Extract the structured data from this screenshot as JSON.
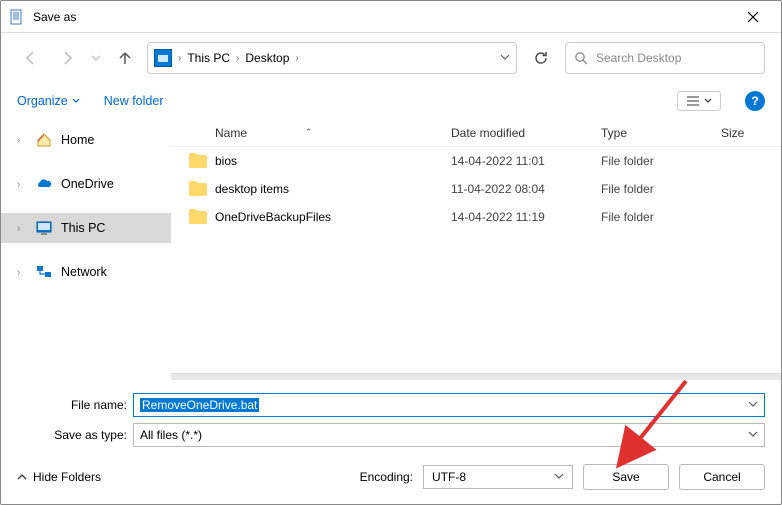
{
  "window": {
    "title": "Save as"
  },
  "address": {
    "segments": [
      "This PC",
      "Desktop"
    ],
    "search_placeholder": "Search Desktop"
  },
  "toolbar": {
    "organize": "Organize",
    "new_folder": "New folder"
  },
  "sidebar": {
    "items": [
      {
        "label": "Home",
        "icon": "home-icon",
        "active": false
      },
      {
        "label": "OneDrive",
        "icon": "onedrive-icon",
        "active": false
      },
      {
        "label": "This PC",
        "icon": "thispc-icon",
        "active": true
      },
      {
        "label": "Network",
        "icon": "network-icon",
        "active": false
      }
    ]
  },
  "columns": {
    "name": "Name",
    "date": "Date modified",
    "type": "Type",
    "size": "Size"
  },
  "files": [
    {
      "name": "bios",
      "date": "14-04-2022 11:01",
      "type": "File folder"
    },
    {
      "name": "desktop items",
      "date": "11-04-2022 08:04",
      "type": "File folder"
    },
    {
      "name": "OneDriveBackupFiles",
      "date": "14-04-2022 11:19",
      "type": "File folder"
    }
  ],
  "form": {
    "file_name_label": "File name:",
    "file_name_value": "RemoveOneDrive.bat",
    "save_type_label": "Save as type:",
    "save_type_value": "All files  (*.*)",
    "encoding_label": "Encoding:",
    "encoding_value": "UTF-8"
  },
  "footer": {
    "hide_folders": "Hide Folders",
    "save": "Save",
    "cancel": "Cancel"
  }
}
